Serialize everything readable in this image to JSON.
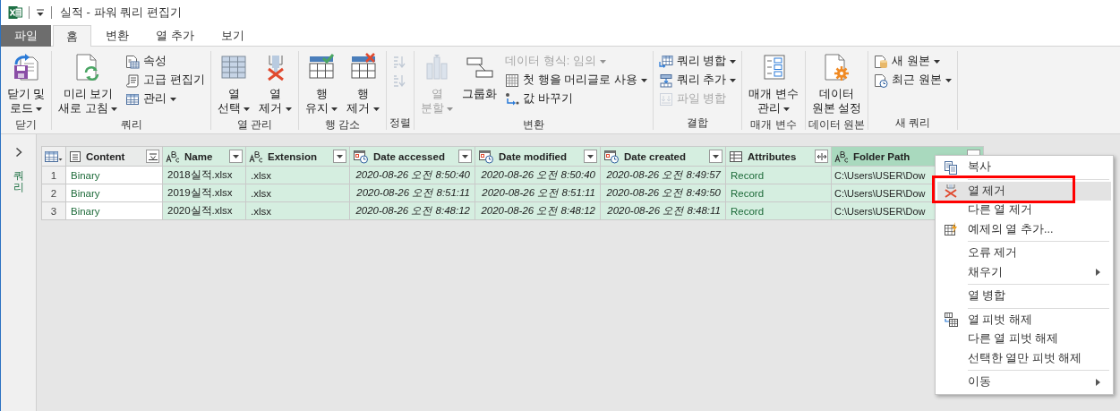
{
  "window": {
    "title": "실적 - 파워 쿼리 편집기"
  },
  "tabs": [
    {
      "label": "파일",
      "kind": "file",
      "selected": false
    },
    {
      "label": "홈",
      "kind": "tab",
      "selected": true
    },
    {
      "label": "변환",
      "kind": "tab",
      "selected": false
    },
    {
      "label": "열 추가",
      "kind": "tab",
      "selected": false
    },
    {
      "label": "보기",
      "kind": "tab",
      "selected": false
    }
  ],
  "ribbon": {
    "groups": [
      {
        "label": "닫기",
        "columns": [
          [
            {
              "label": "닫기 및\n로드",
              "kind": "large",
              "dropdown": true,
              "disabled": false
            }
          ]
        ]
      },
      {
        "label": "쿼리",
        "columns": [
          [
            {
              "label": "미리 보기\n새로 고침",
              "kind": "large",
              "dropdown": true,
              "disabled": false
            }
          ],
          [
            {
              "label": "속성",
              "kind": "small",
              "dropdown": false,
              "disabled": false
            },
            {
              "label": "고급 편집기",
              "kind": "small",
              "dropdown": false,
              "disabled": false
            },
            {
              "label": "관리",
              "kind": "small",
              "dropdown": true,
              "disabled": false
            }
          ]
        ]
      },
      {
        "label": "열 관리",
        "columns": [
          [
            {
              "label": "열\n선택",
              "kind": "large",
              "dropdown": true,
              "disabled": false
            }
          ],
          [
            {
              "label": "열\n제거",
              "kind": "large",
              "dropdown": true,
              "disabled": false
            }
          ]
        ]
      },
      {
        "label": "행 감소",
        "columns": [
          [
            {
              "label": "행\n유지",
              "kind": "large",
              "dropdown": true,
              "disabled": false
            }
          ],
          [
            {
              "label": "행\n제거",
              "kind": "large",
              "dropdown": true,
              "disabled": false
            }
          ]
        ]
      },
      {
        "label": "정렬",
        "columns": [
          [
            {
              "kind": "small",
              "dropdown": false,
              "disabled": true
            },
            {
              "kind": "small",
              "dropdown": false,
              "disabled": true
            }
          ]
        ]
      },
      {
        "label": "변환",
        "columns": [
          [
            {
              "label": "열\n분할",
              "kind": "large",
              "dropdown": true,
              "disabled": true
            }
          ],
          [
            {
              "label": "그룹화",
              "kind": "large",
              "dropdown": false,
              "disabled": false
            }
          ],
          [
            {
              "label": "데이터 형식: 임의",
              "kind": "small",
              "dropdown": true,
              "disabled": true
            },
            {
              "label": "첫 행을 머리글로 사용",
              "kind": "small",
              "dropdown": true,
              "disabled": false
            },
            {
              "label": "값 바꾸기",
              "kind": "small",
              "dropdown": false,
              "disabled": false
            }
          ]
        ]
      },
      {
        "label": "결합",
        "columns": [
          [
            {
              "label": "쿼리 병합",
              "kind": "small",
              "dropdown": true,
              "disabled": false
            },
            {
              "label": "쿼리 추가",
              "kind": "small",
              "dropdown": true,
              "disabled": false
            },
            {
              "label": "파일 병합",
              "kind": "small",
              "dropdown": false,
              "disabled": true
            }
          ]
        ]
      },
      {
        "label": "매개 변수",
        "columns": [
          [
            {
              "label": "매개 변수\n관리",
              "kind": "large",
              "dropdown": true,
              "disabled": false
            }
          ]
        ]
      },
      {
        "label": "데이터 원본",
        "columns": [
          [
            {
              "label": "데이터\n원본 설정",
              "kind": "large",
              "dropdown": false,
              "disabled": false
            }
          ]
        ]
      },
      {
        "label": "새 쿼리",
        "columns": [
          [
            {
              "label": "새 원본",
              "kind": "small",
              "dropdown": true,
              "disabled": false
            },
            {
              "label": "최근 원본",
              "kind": "small",
              "dropdown": true,
              "disabled": false
            }
          ]
        ]
      }
    ]
  },
  "query_pane": {
    "label": "쿼리"
  },
  "table": {
    "columns": [
      {
        "label": "Content",
        "kind": "binary",
        "selected": false,
        "focused": false
      },
      {
        "label": "Name",
        "kind": "text",
        "selected": true,
        "focused": false
      },
      {
        "label": "Extension",
        "kind": "text",
        "selected": true,
        "focused": false
      },
      {
        "label": "Date accessed",
        "kind": "datetime",
        "selected": true,
        "focused": false
      },
      {
        "label": "Date modified",
        "kind": "datetime",
        "selected": true,
        "focused": false
      },
      {
        "label": "Date created",
        "kind": "datetime",
        "selected": true,
        "focused": false
      },
      {
        "label": "Attributes",
        "kind": "record",
        "selected": true,
        "focused": false
      },
      {
        "label": "Folder Path",
        "kind": "text",
        "selected": true,
        "focused": true
      }
    ],
    "rows": [
      {
        "number": "1",
        "cells": [
          "Binary",
          "2018실적.xlsx",
          ".xlsx",
          "2020-08-26 오전 8:50:40",
          "2020-08-26 오전 8:50:40",
          "2020-08-26 오전 8:49:57",
          "Record",
          "C:\\Users\\USER\\Dow"
        ]
      },
      {
        "number": "2",
        "cells": [
          "Binary",
          "2019실적.xlsx",
          ".xlsx",
          "2020-08-26 오전 8:51:11",
          "2020-08-26 오전 8:51:11",
          "2020-08-26 오전 8:49:50",
          "Record",
          "C:\\Users\\USER\\Dow"
        ]
      },
      {
        "number": "3",
        "cells": [
          "Binary",
          "2020실적.xlsx",
          ".xlsx",
          "2020-08-26 오전 8:48:12",
          "2020-08-26 오전 8:48:12",
          "2020-08-26 오전 8:48:11",
          "Record",
          "C:\\Users\\USER\\Dow"
        ]
      }
    ]
  },
  "context_menu": {
    "sections": [
      [
        {
          "label": "복사",
          "highlighted": false,
          "outlined": false,
          "submenu": false
        }
      ],
      [
        {
          "label": "열 제거",
          "highlighted": true,
          "outlined": true,
          "submenu": false
        },
        {
          "label": "다른 열 제거",
          "highlighted": false,
          "outlined": false,
          "submenu": false
        },
        {
          "label": "예제의 열 추가...",
          "highlighted": false,
          "outlined": false,
          "submenu": false
        }
      ],
      [
        {
          "label": "오류 제거",
          "highlighted": false,
          "outlined": false,
          "submenu": false
        },
        {
          "label": "채우기",
          "highlighted": false,
          "outlined": false,
          "submenu": true
        }
      ],
      [
        {
          "label": "열 병합",
          "highlighted": false,
          "outlined": false,
          "submenu": false
        }
      ],
      [
        {
          "label": "열 피벗 해제",
          "highlighted": false,
          "outlined": false,
          "submenu": false
        },
        {
          "label": "다른 열 피벗 해제",
          "highlighted": false,
          "outlined": false,
          "submenu": false
        },
        {
          "label": "선택한 열만 피벗 해제",
          "highlighted": false,
          "outlined": false,
          "submenu": false
        }
      ],
      [
        {
          "label": "이동",
          "highlighted": false,
          "outlined": false,
          "submenu": true
        }
      ]
    ]
  }
}
